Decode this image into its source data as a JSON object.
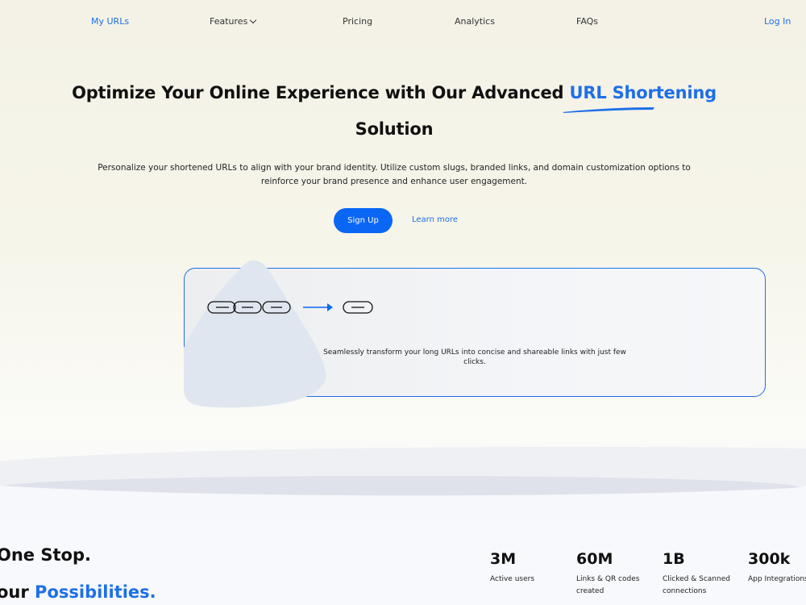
{
  "nav": {
    "my_urls": "My URLs",
    "features": "Features",
    "pricing": "Pricing",
    "analytics": "Analytics",
    "faqs": "FAQs",
    "login": "Log In"
  },
  "hero": {
    "title_part1": "Optimize Your Online Experience with Our Advanced",
    "title_accent": "URL Shortening",
    "title_part2": "Solution",
    "description_line1": "Personalize your shortened URLs to align with your brand identity. Utilize custom slugs, branded links, and domain customization options to",
    "description_line2": "reinforce your brand presence and enhance user engagement.",
    "signup_label": "Sign Up",
    "learn_more_label": "Learn more"
  },
  "card": {
    "text_line1": "Seamlessly transform your long URLs into concise and shareable links with just few",
    "text_line2": "clicks."
  },
  "lower": {
    "line1": "One Stop.",
    "line2_part1": "our",
    "line2_accent": "Possibilities."
  },
  "stats": [
    {
      "value": "3M",
      "label_line1": "Active users",
      "label_line2": ""
    },
    {
      "value": "60M",
      "label_line1": "Links & QR codes",
      "label_line2": "created"
    },
    {
      "value": "1B",
      "label_line1": "Clicked & Scanned",
      "label_line2": "connections"
    },
    {
      "value": "300k",
      "label_line1": "App Integrations",
      "label_line2": ""
    }
  ],
  "colors": {
    "accent": "#1e6fe8",
    "button": "#0a66f5"
  },
  "icons": [
    "chevron-down-icon",
    "chain-link-icon",
    "arrow-right-icon",
    "short-link-icon"
  ]
}
